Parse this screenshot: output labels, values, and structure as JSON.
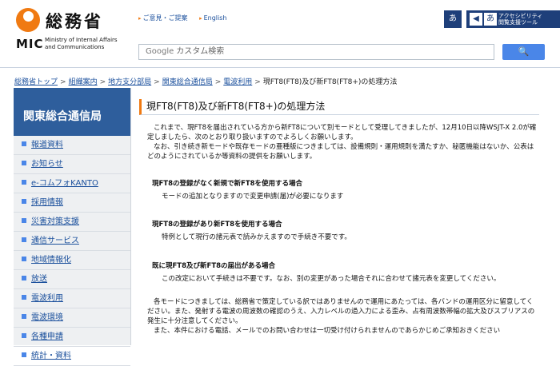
{
  "header": {
    "logo_ja": "総務省",
    "logo_mic": "MIC",
    "logo_en_line1": "Ministry of Internal Affairs",
    "logo_en_line2": "and Communications",
    "link_opinion": "ご意見・ご提案",
    "link_english": "English",
    "tool_a_label": "あ",
    "tool_b_line1": "アクセシビリティ",
    "tool_b_line2": "閲覧支援ツール",
    "search_brand": "Google",
    "search_placeholder": "カスタム検索",
    "search_button": "🔍"
  },
  "breadcrumb": {
    "items": [
      "総務省トップ",
      "組織案内",
      "地方支分部局",
      "関東総合通信局",
      "電波利用"
    ],
    "current": "現FT8(FT8)及び新FT8(FT8+)の処理方法"
  },
  "sidebar": {
    "title": "関東総合通信局",
    "items": [
      "報道資料",
      "お知らせ",
      "e-コムフォKANTO",
      "採用情報",
      "災害対策支援",
      "通信サービス",
      "地域情報化",
      "放送",
      "電波利用",
      "電波環境",
      "各種申請",
      "統計・資料"
    ]
  },
  "main": {
    "title": "現FT8(FT8)及び新FT8(FT8+)の処理方法",
    "intro_1": "これまで、現FT8を届出されている方から新FT8について別モードとして受理してきましたが、12月10日以降WSJT-X 2.0が確定しましたら、次のとおり取り扱いますのでよろしくお願いします。",
    "intro_2": "なお、引き続き新モードや既存モードの亜種版につきましては、設備規則・運用規則を満たすか、秘匿機能はないか、公表はどのようにされているか等資料の提供をお願いします。",
    "case1_heading": "現FT8の登録がなく新規で新FT8を使用する場合",
    "case1_text": "モードの追加となりますので変更申請(届)が必要になります",
    "case2_heading": "現FT8の登録があり新FT8を使用する場合",
    "case2_text": "特例として現行の諸元表で読みかえますので手続き不要です。",
    "case3_heading": "既に現FT8及び新FT8の届出がある場合",
    "case3_text": "この改定において手続きは不要です。なお、別の変更があった場合それに合わせて諸元表を変更してください。",
    "note_1": "各モードにつきましては、総務省で策定している訳ではありませんので運用にあたっては、各バンドの運用区分に留意してください。また、発射する電波の周波数の確認のうえ、入力レベルの過入力による歪み、占有周波数帯幅の拡大及びスプリアスの発生に十分注意してください。",
    "note_2": "また、本件における電話、メールでのお問い合わせは一切受け付けられませんのであらかじめご承知おきください"
  }
}
